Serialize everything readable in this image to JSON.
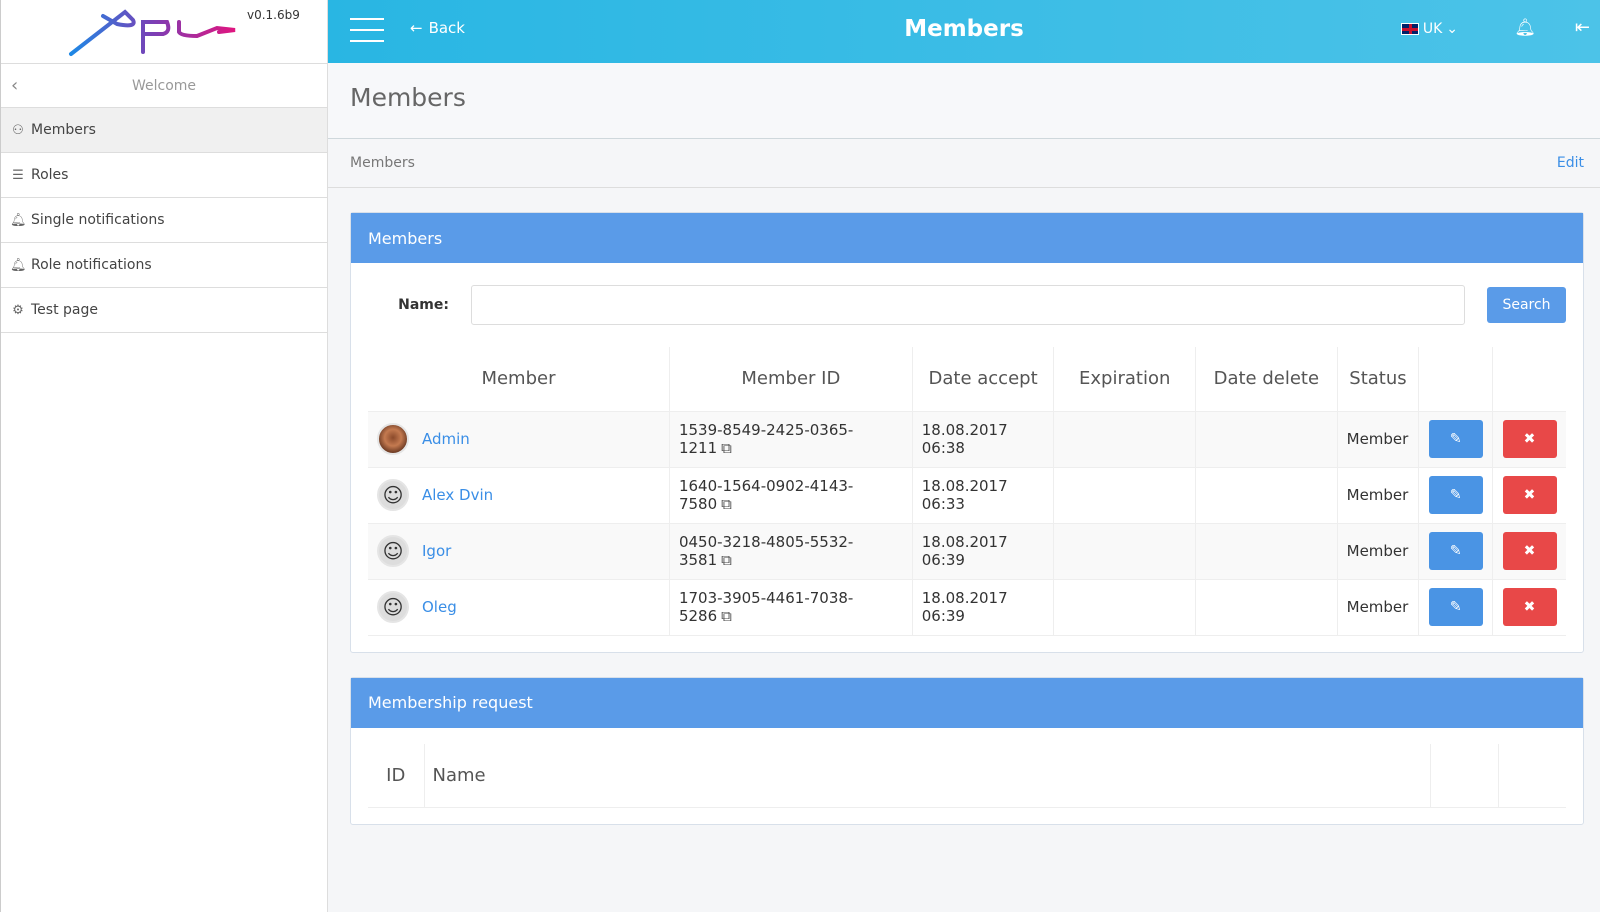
{
  "app": {
    "version": "v0.1.6b9",
    "logo_text": "Xpus"
  },
  "sidebar": {
    "welcome": "Welcome",
    "items": [
      {
        "label": "Members",
        "icon": "user-icon",
        "active": true
      },
      {
        "label": "Roles",
        "icon": "list-icon"
      },
      {
        "label": "Single notifications",
        "icon": "bell-icon"
      },
      {
        "label": "Role notifications",
        "icon": "bell-icon"
      },
      {
        "label": "Test page",
        "icon": "gear-icon"
      }
    ]
  },
  "topbar": {
    "back": "Back",
    "title": "Members",
    "lang": "UK"
  },
  "page": {
    "title": "Members",
    "breadcrumb": "Members",
    "edit": "Edit"
  },
  "members_panel": {
    "title": "Members",
    "name_label": "Name:",
    "name_value": "",
    "search": "Search",
    "columns": [
      "Member",
      "Member ID",
      "Date accept",
      "Expiration",
      "Date delete",
      "Status",
      "",
      ""
    ],
    "rows": [
      {
        "name": "Admin",
        "id": "1539-8549-2425-0365-1211",
        "date_accept": "18.08.2017 06:38",
        "expiration": "",
        "date_delete": "",
        "status": "Member"
      },
      {
        "name": "Alex Dvin",
        "id": "1640-1564-0902-4143-7580",
        "date_accept": "18.08.2017 06:33",
        "expiration": "",
        "date_delete": "",
        "status": "Member"
      },
      {
        "name": "Igor",
        "id": "0450-3218-4805-5532-3581",
        "date_accept": "18.08.2017 06:39",
        "expiration": "",
        "date_delete": "",
        "status": "Member"
      },
      {
        "name": "Oleg",
        "id": "1703-3905-4461-7038-5286",
        "date_accept": "18.08.2017 06:39",
        "expiration": "",
        "date_delete": "",
        "status": "Member"
      }
    ]
  },
  "request_panel": {
    "title": "Membership request",
    "columns": [
      "ID",
      "Name"
    ]
  },
  "colors": {
    "topbar": "#29b6e3",
    "panel_header": "#5a9be8",
    "edit_btn": "#4a94e4",
    "delete_btn": "#e84848",
    "link": "#3a8ee6"
  }
}
